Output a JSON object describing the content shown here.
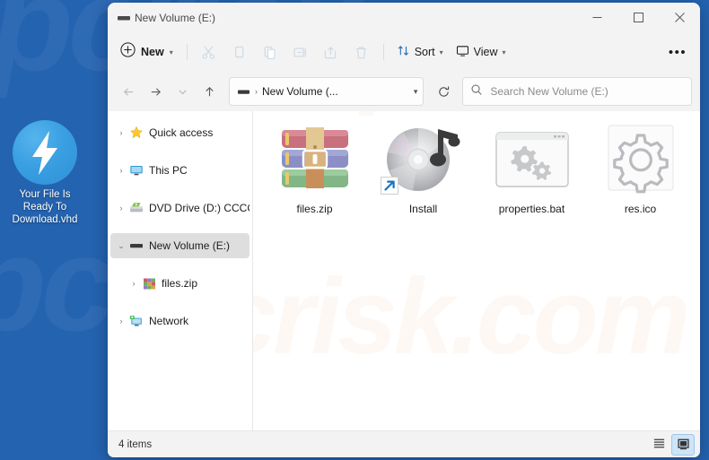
{
  "desktop": {
    "background_color": "#2463B0",
    "watermark_text": "pcrisk",
    "icon": {
      "name": "bolt-icon",
      "label_line1": "Your File Is",
      "label_line2": "Ready To",
      "label_line3": "Download.vhd",
      "color": "#3aa0e2"
    }
  },
  "window": {
    "title": "New Volume (E:)",
    "title_icon": "drive-icon",
    "controls": {
      "minimize": "—",
      "maximize": "☐",
      "close": "✕"
    },
    "watermark_text": "pcrisk.com"
  },
  "toolbar": {
    "new_label": "New",
    "new_icon": "plus-circle-icon",
    "items": [
      {
        "name": "cut-button",
        "icon": "scissors-icon",
        "enabled": false
      },
      {
        "name": "copy-button",
        "icon": "copy-icon",
        "enabled": false
      },
      {
        "name": "paste-button",
        "icon": "clipboard-icon",
        "enabled": false
      },
      {
        "name": "rename-button",
        "icon": "rename-icon",
        "enabled": false
      },
      {
        "name": "share-button",
        "icon": "share-icon",
        "enabled": false
      },
      {
        "name": "delete-button",
        "icon": "trash-icon",
        "enabled": false
      }
    ],
    "sort_label": "Sort",
    "sort_icon": "sort-arrows-icon",
    "view_label": "View",
    "view_icon": "monitor-icon",
    "more_label": "•••"
  },
  "addressbar": {
    "back_icon": "arrow-left-icon",
    "forward_icon": "arrow-right-icon",
    "recent_icon": "chevron-down-icon",
    "up_icon": "arrow-up-icon",
    "path_icon": "drive-icon",
    "path_separator": "›",
    "path_text": "New Volume (...",
    "path_chevron": "⌄",
    "refresh_icon": "refresh-icon",
    "search_icon": "search-icon",
    "search_placeholder": "Search New Volume (E:)"
  },
  "sidebar": {
    "items": [
      {
        "label": "Quick access",
        "icon": "star-icon",
        "expander": "›",
        "expanded": false,
        "selected": false,
        "indent": false
      },
      {
        "label": "This PC",
        "icon": "monitor-icon",
        "expander": "›",
        "expanded": false,
        "selected": false,
        "indent": false
      },
      {
        "label": "DVD Drive (D:) CCCC",
        "icon": "dvd-drive-icon",
        "expander": "›",
        "expanded": false,
        "selected": false,
        "indent": false
      },
      {
        "label": "New Volume (E:)",
        "icon": "drive-icon",
        "expander": "⌄",
        "expanded": true,
        "selected": true,
        "indent": false
      },
      {
        "label": "files.zip",
        "icon": "zip-icon",
        "expander": "›",
        "expanded": false,
        "selected": false,
        "indent": true
      },
      {
        "label": "Network",
        "icon": "network-icon",
        "expander": "›",
        "expanded": false,
        "selected": false,
        "indent": false
      }
    ]
  },
  "files": [
    {
      "name": "files.zip",
      "icon": "winrar-archive-icon",
      "shortcut": false
    },
    {
      "name": "Install",
      "icon": "media-disc-icon",
      "shortcut": true
    },
    {
      "name": "properties.bat",
      "icon": "batch-script-icon",
      "shortcut": false
    },
    {
      "name": "res.ico",
      "icon": "gear-icon-file",
      "shortcut": false
    }
  ],
  "statusbar": {
    "item_count": "4 items",
    "views": [
      {
        "name": "details-view-button",
        "icon": "list-lines-icon",
        "active": false
      },
      {
        "name": "large-icons-view-button",
        "icon": "large-icon-view-icon",
        "active": true
      }
    ]
  }
}
